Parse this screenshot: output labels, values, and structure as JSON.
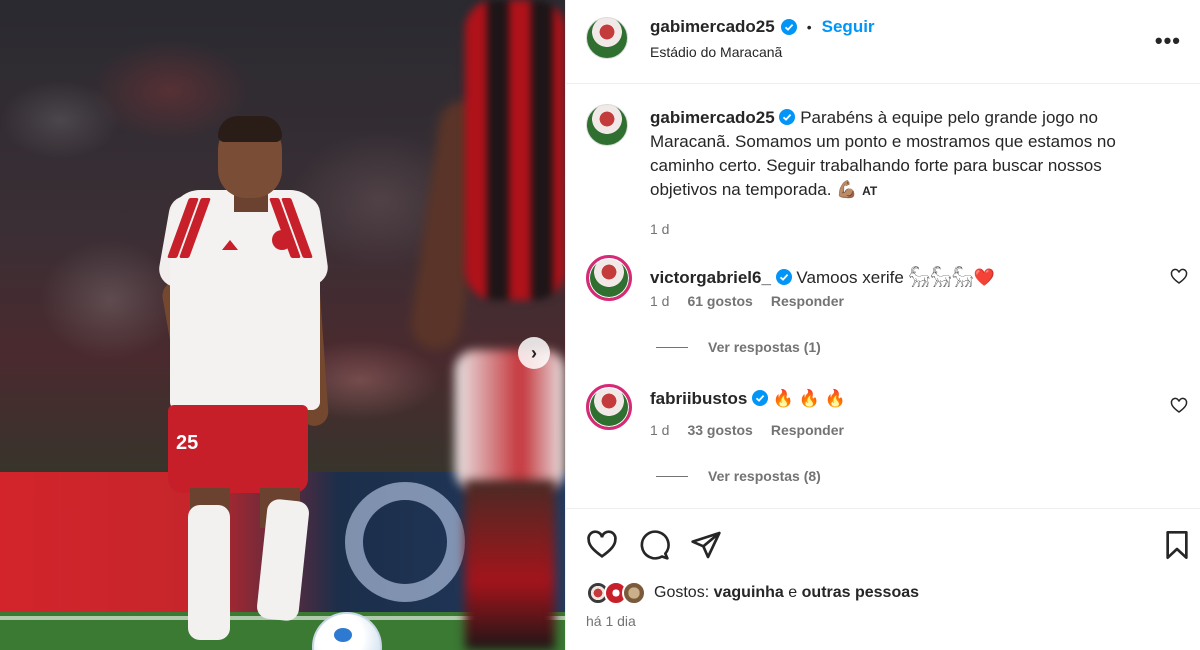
{
  "post": {
    "username": "gabimercado25",
    "location": "Estádio do Maracanã",
    "follow_label": "Seguir",
    "separator": "•",
    "more_label": "•••",
    "caption": "Parabéns à equipe pelo grande jogo no Maracanã. Somamos um ponto e mostramos que estamos no caminho certo. Seguir trabalhando forte para buscar nossos objetivos na temporada. 💪🏽",
    "caption_tag": "AT",
    "caption_time": "1 d",
    "jersey_number": "25"
  },
  "comments": [
    {
      "username": "victorgabriel6_",
      "text": "Vamoos xerife 𓃵𓃵𓃵",
      "heart": "❤️",
      "time": "1 d",
      "likes": "61 gostos",
      "reply_label": "Responder",
      "view_replies": "Ver respostas (1)"
    },
    {
      "username": "fabriibustos",
      "text": "🔥 🔥 🔥",
      "time": "1 d",
      "likes": "33 gostos",
      "reply_label": "Responder",
      "view_replies": "Ver respostas (8)"
    }
  ],
  "footer": {
    "likes_prefix": "Gostos:",
    "likes_user": "vaguinha",
    "likes_join": "e",
    "likes_others": "outras pessoas",
    "date": "há 1 dia"
  },
  "icons": {
    "like": "heart-icon",
    "comment": "comment-icon",
    "share": "send-icon",
    "save": "bookmark-icon",
    "next": "chevron-right-icon",
    "verified": "verified-badge-icon"
  },
  "colors": {
    "link": "#0095f6",
    "verified": "#0095f6",
    "muted": "#737373",
    "text": "#262626"
  }
}
